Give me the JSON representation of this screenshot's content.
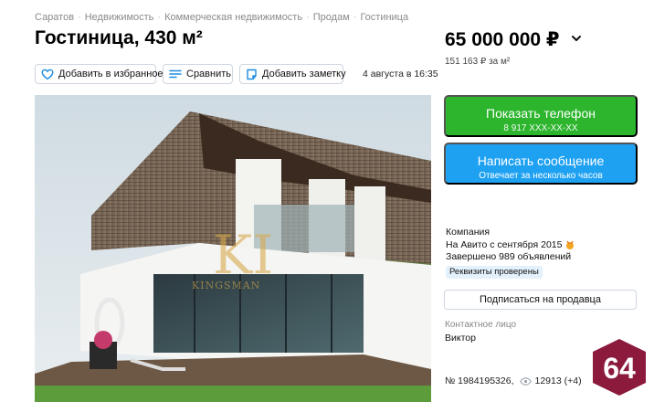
{
  "breadcrumb": [
    "Саратов",
    "Недвижимость",
    "Коммерческая недвижимость",
    "Продам",
    "Гостиница"
  ],
  "title": "Гостиница, 430 м²",
  "price": {
    "value": "65 000 000 ₽",
    "per_m2": "151 163 ₽ за м²"
  },
  "actions": {
    "favorite": "Добавить в избранное",
    "compare": "Сравнить",
    "note": "Добавить заметку",
    "date": "4 августа в 16:35"
  },
  "photo": {
    "watermark_name": "KINGSMAN",
    "watermark_initials": "KI"
  },
  "contact_buttons": {
    "call_label": "Показать телефон",
    "call_number": "8 917 XXX-XX-XX",
    "message_label": "Написать сообщение",
    "message_sub": "Отвечает за несколько часов"
  },
  "seller": {
    "type": "Компания",
    "since": "На Авито с сентября 2015",
    "completed": "Завершено 989 объявлений",
    "verified_badge": "Реквизиты проверены",
    "subscribe": "Подписаться на продавца",
    "contact_label": "Контактное лицо",
    "contact_name": "Виктор"
  },
  "ad": {
    "number": "№ 1984195326,",
    "views": "12913 (+4)"
  },
  "logo": {
    "text": "64",
    "color": "#8b1a3c"
  },
  "colors": {
    "call": "#2db52e",
    "message": "#1fa1f2",
    "badge": "#e3f1fc"
  }
}
